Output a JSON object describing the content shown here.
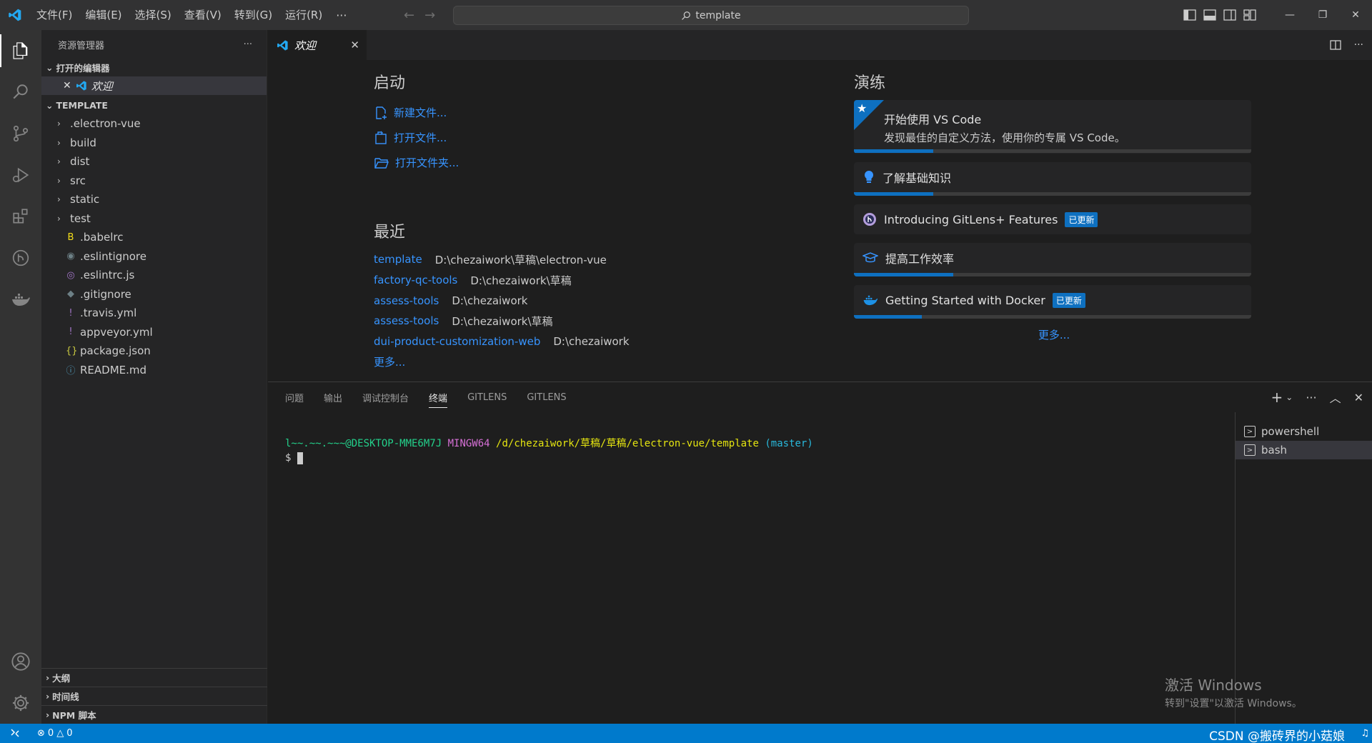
{
  "titlebar": {
    "menus": [
      "文件(F)",
      "编辑(E)",
      "选择(S)",
      "查看(V)",
      "转到(G)",
      "运行(R)"
    ],
    "more": "···",
    "search_text": "template"
  },
  "sidebar": {
    "title": "资源管理器",
    "more": "···",
    "open_editors_label": "打开的编辑器",
    "open_editor_name": "欢迎",
    "folder_label": "TEMPLATE",
    "folders": [
      ".electron-vue",
      "build",
      "dist",
      "src",
      "static",
      "test"
    ],
    "files": [
      {
        "name": ".babelrc",
        "icon": "babel-icon",
        "color": "#f5de19"
      },
      {
        "name": ".eslintignore",
        "icon": "eslint-ignore-icon",
        "color": "#6d8086"
      },
      {
        "name": ".eslintrc.js",
        "icon": "eslint-icon",
        "color": "#a074c4"
      },
      {
        "name": ".gitignore",
        "icon": "git-icon",
        "color": "#6d8086"
      },
      {
        "name": ".travis.yml",
        "icon": "yaml-icon",
        "color": "#a074c4"
      },
      {
        "name": "appveyor.yml",
        "icon": "yaml-icon",
        "color": "#a074c4"
      },
      {
        "name": "package.json",
        "icon": "json-icon",
        "color": "#cbcb41"
      },
      {
        "name": "README.md",
        "icon": "info-icon",
        "color": "#519aba"
      }
    ],
    "bottom_sections": [
      "大纲",
      "时间线",
      "NPM 脚本"
    ]
  },
  "editor": {
    "tab_label": "欢迎",
    "start": {
      "heading": "启动",
      "items": [
        "新建文件...",
        "打开文件...",
        "打开文件夹..."
      ]
    },
    "recent": {
      "heading": "最近",
      "items": [
        {
          "name": "template",
          "path": "D:\\chezaiwork\\草稿\\electron-vue"
        },
        {
          "name": "factory-qc-tools",
          "path": "D:\\chezaiwork\\草稿"
        },
        {
          "name": "assess-tools",
          "path": "D:\\chezaiwork"
        },
        {
          "name": "assess-tools",
          "path": "D:\\chezaiwork\\草稿"
        },
        {
          "name": "dui-product-customization-web",
          "path": "D:\\chezaiwork"
        }
      ],
      "more": "更多..."
    },
    "walkthroughs": {
      "heading": "演练",
      "featured": {
        "title": "开始使用 VS Code",
        "description": "发现最佳的自定义方法，使用你的专属 VS Code。",
        "progress": 0.2
      },
      "items": [
        {
          "title": "了解基础知识",
          "progress": 0.2,
          "badge": ""
        },
        {
          "title": "Introducing GitLens+ Features",
          "progress": 0,
          "badge": "已更新"
        },
        {
          "title": "提高工作效率",
          "progress": 0.25,
          "badge": ""
        },
        {
          "title": "Getting Started with Docker",
          "progress": 0.17,
          "badge": "已更新"
        }
      ],
      "more": "更多..."
    }
  },
  "panel": {
    "tabs": [
      "问题",
      "输出",
      "调试控制台",
      "终端",
      "GITLENS",
      "GITLENS"
    ],
    "active_tab": "终端",
    "terminal": {
      "user": "l~~.~~.~~~@DESKTOP-MME6M7J",
      "env": "MINGW64",
      "path": "/d/chezaiwork/草稿/草稿/electron-vue/template",
      "branch": "(master)",
      "prompt": "$"
    },
    "terminals": [
      "powershell",
      "bash"
    ]
  },
  "watermark": {
    "line1": "激活 Windows",
    "line2": "转到\"设置\"以激活 Windows。"
  },
  "statusbar": {
    "errors": "0",
    "warnings": "0",
    "csdn": "CSDN @搬砖界的小菇娘"
  },
  "colors": {
    "accent": "#007acc",
    "link": "#3794ff",
    "progress": "#0e70c0"
  }
}
